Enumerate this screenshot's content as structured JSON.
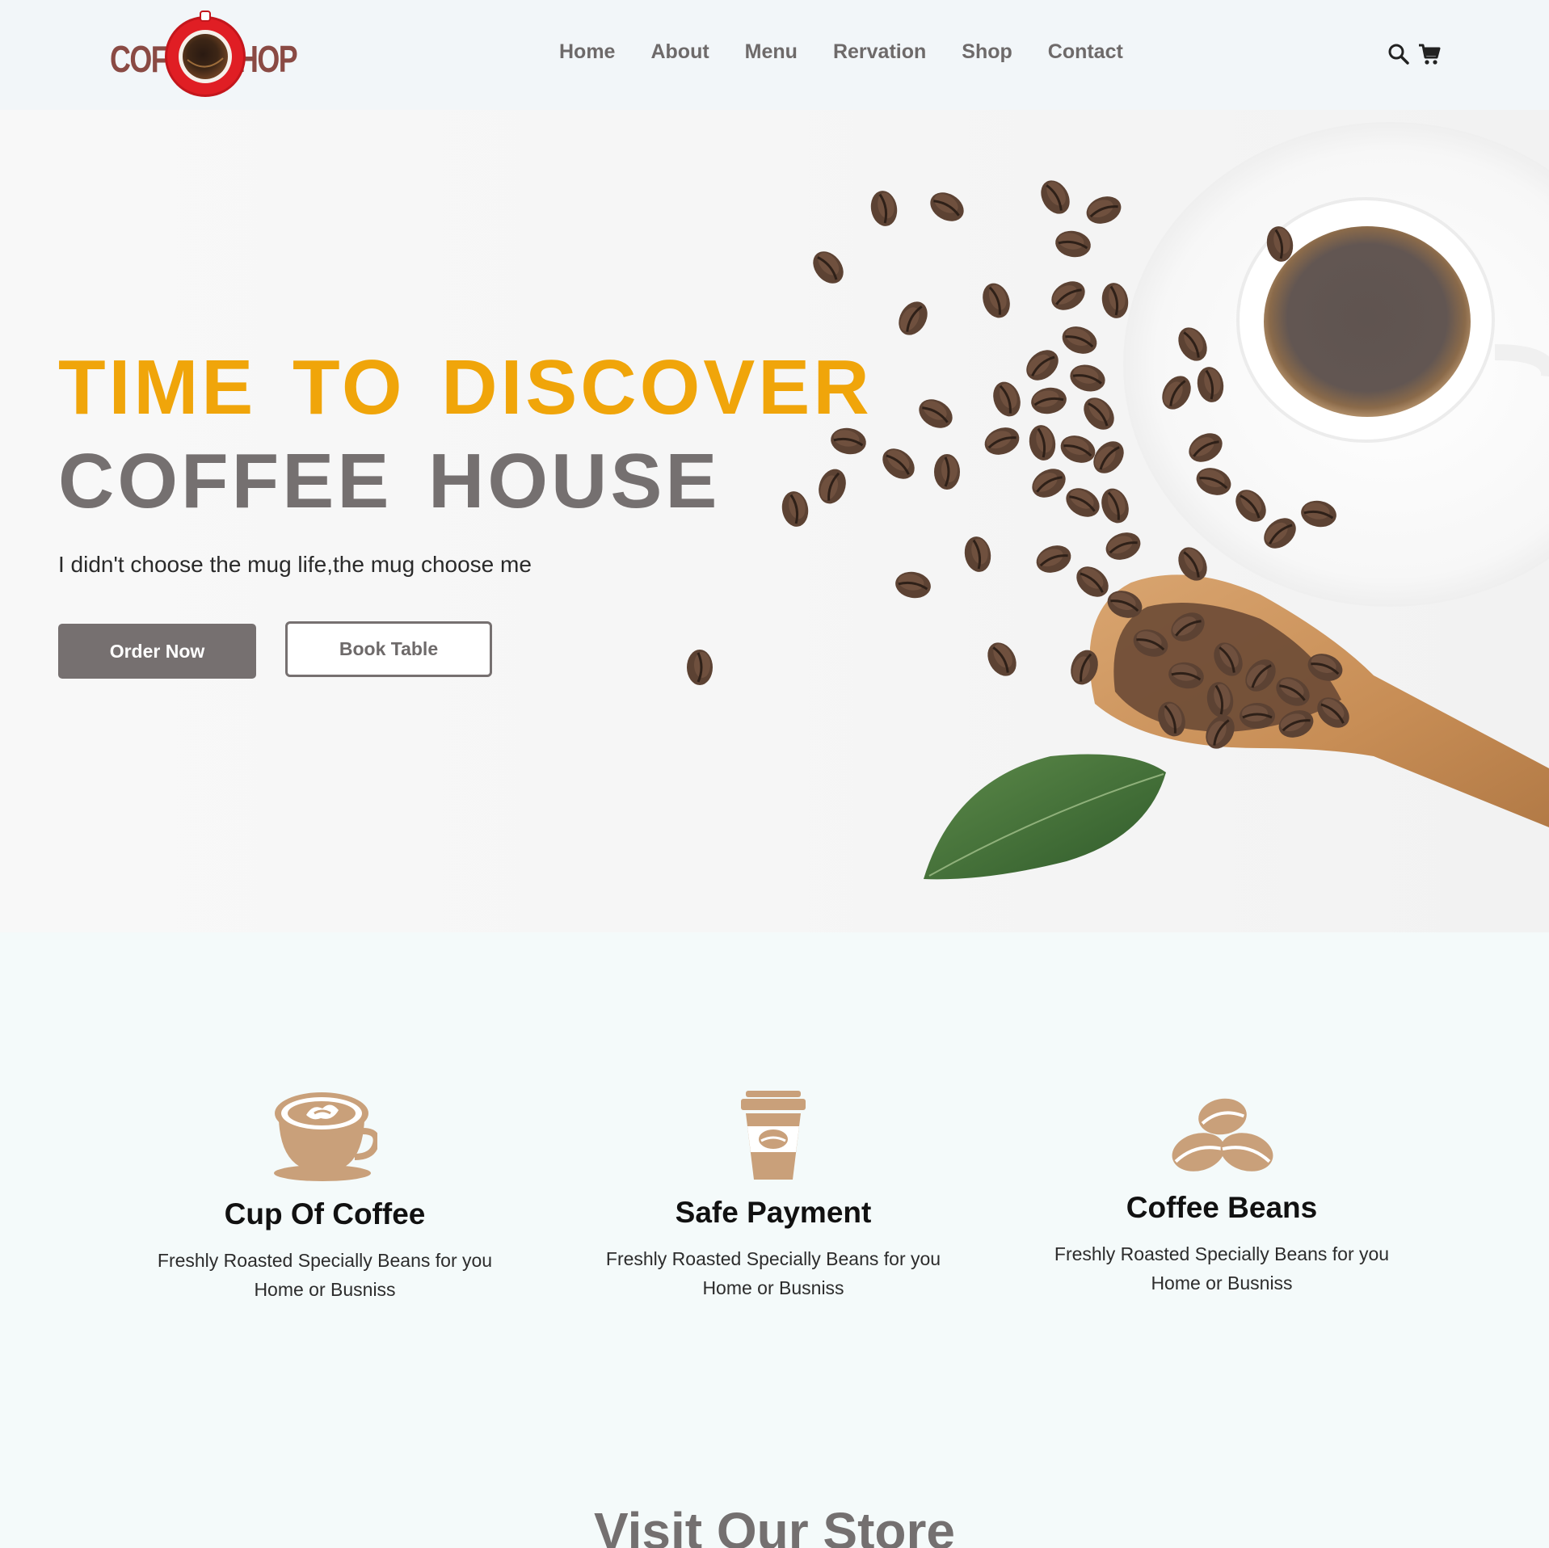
{
  "logo": {
    "left_text": "COF",
    "right_text": "HOP",
    "icon": "coffee-cup-logo"
  },
  "nav": {
    "items": [
      {
        "label": "Home"
      },
      {
        "label": "About"
      },
      {
        "label": "Menu"
      },
      {
        "label": "Rervation"
      },
      {
        "label": "Shop"
      },
      {
        "label": "Contact"
      }
    ]
  },
  "header_icons": {
    "search": "search-icon",
    "cart": "cart-icon"
  },
  "hero": {
    "line1": "TIME TO DISCOVER",
    "line2": "COFFEE HOUSE",
    "tagline": "I didn't choose the mug life,the mug choose me",
    "order_label": "Order Now",
    "book_label": "Book Table",
    "image": "coffee-cup-beans-scoop-leaf"
  },
  "features": [
    {
      "icon": "coffee-cup-icon",
      "title": "Cup Of Coffee",
      "text": "Freshly Roasted Specially Beans for you Home or Busniss"
    },
    {
      "icon": "takeaway-cup-icon",
      "title": "Safe Payment",
      "text": "Freshly Roasted Specially Beans for you Home or Busniss"
    },
    {
      "icon": "coffee-beans-icon",
      "title": "Coffee Beans",
      "text": "Freshly Roasted Specially Beans for you Home or Busniss"
    }
  ],
  "store": {
    "heading": "Visit Our Store"
  },
  "colors": {
    "accent": "#f0a50a",
    "gray_text": "#757070",
    "icon_tan": "#c9a07a",
    "logo_red": "#d01818"
  }
}
